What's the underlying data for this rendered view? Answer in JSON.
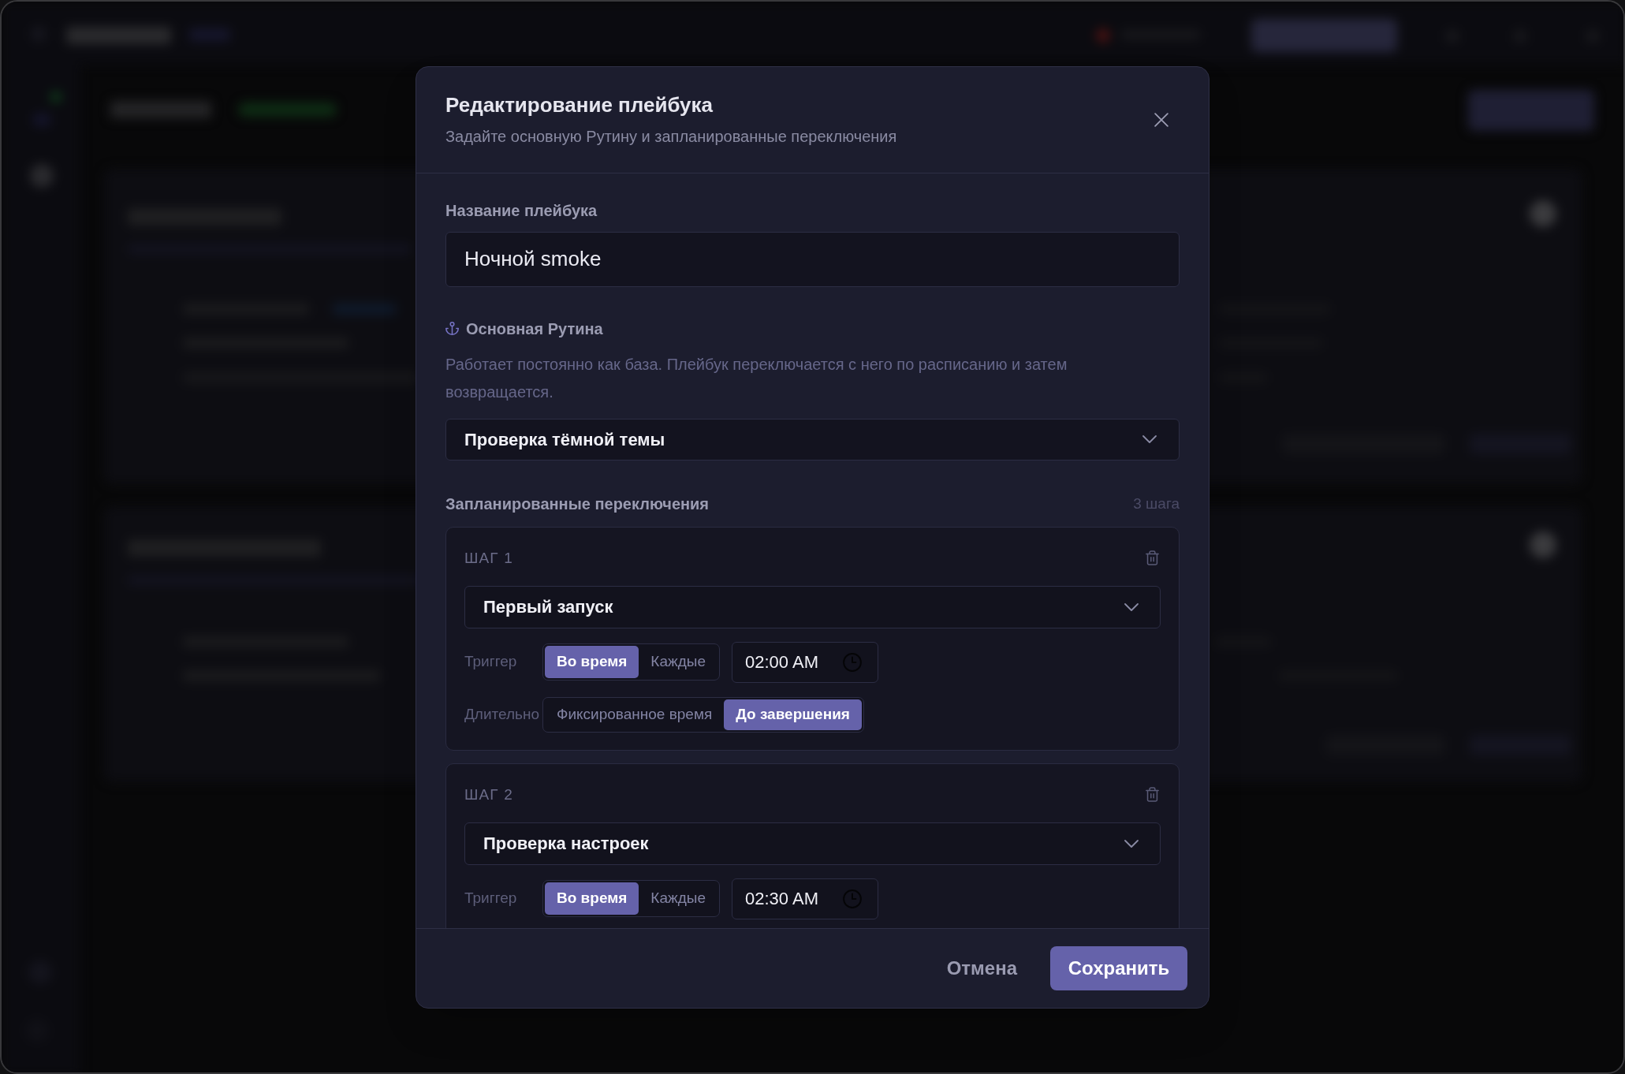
{
  "dialog": {
    "title": "Редактирование плейбука",
    "subtitle": "Задайте основную Рутину и запланированные переключения"
  },
  "name_field": {
    "label": "Название плейбука",
    "value": "Ночной smoke"
  },
  "base_routine": {
    "label": "Основная Рутина",
    "description": "Работает постоянно как база. Плейбук переключается с него по расписанию и затем возвращается.",
    "value": "Проверка тёмной темы"
  },
  "schedule": {
    "title": "Запланированные переключения",
    "count": "3 шага",
    "steps": [
      {
        "label": "ШАГ 1",
        "routine": "Первый запуск",
        "rows": [
          {
            "label": "Триггер",
            "options": [
              {
                "label": "Во время",
                "selected": true
              },
              {
                "label": "Каждые",
                "selected": false
              }
            ],
            "time": "02:00 AM"
          },
          {
            "label": "Длительно",
            "options": [
              {
                "label": "Фиксированное время",
                "selected": false
              },
              {
                "label": "До завершения",
                "selected": true
              }
            ]
          }
        ]
      },
      {
        "label": "ШАГ 2",
        "routine": "Проверка настроек",
        "rows": [
          {
            "label": "Триггер",
            "options": [
              {
                "label": "Во время",
                "selected": true
              },
              {
                "label": "Каждые",
                "selected": false
              }
            ],
            "time": "02:30 AM"
          }
        ]
      }
    ]
  },
  "footer": {
    "buttons": [
      {
        "label": "Отмена",
        "kind": "secondary"
      },
      {
        "label": "Сохранить",
        "kind": "primary"
      }
    ]
  }
}
